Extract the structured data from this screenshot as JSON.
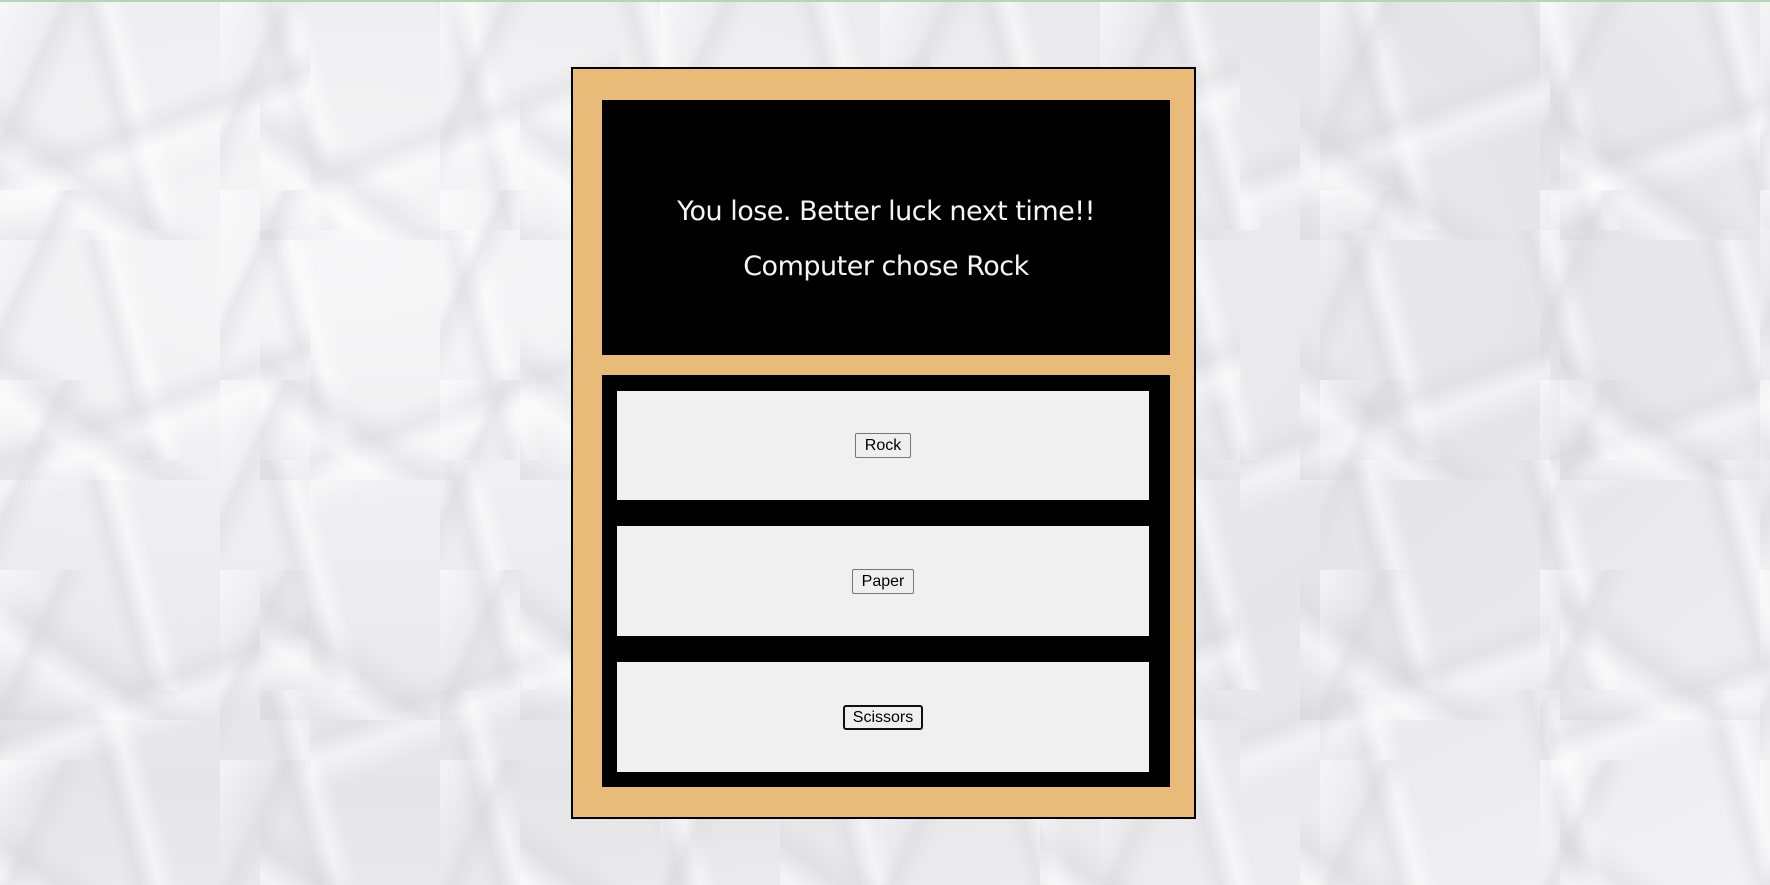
{
  "result": {
    "message": "You lose. Better luck next time!!",
    "computer_choice": "Computer chose Rock"
  },
  "choices": {
    "rock_label": "Rock",
    "paper_label": "Paper",
    "scissors_label": "Scissors"
  },
  "colors": {
    "frame": "#e8bb78",
    "panel": "#000000",
    "card": "#f0f0f0"
  }
}
